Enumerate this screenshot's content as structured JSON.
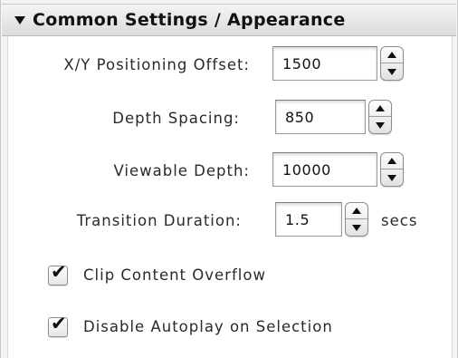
{
  "section": {
    "title": "Common Settings / Appearance",
    "collapse_icon": "disclosure-triangle-down-icon"
  },
  "fields": {
    "xy_offset": {
      "label": "X/Y Positioning Offset:",
      "value": "1500"
    },
    "depth_spacing": {
      "label": "Depth Spacing:",
      "value": "850"
    },
    "viewable_depth": {
      "label": "Viewable Depth:",
      "value": "10000"
    },
    "transition_duration": {
      "label": "Transition Duration:",
      "value": "1.5",
      "unit": "secs"
    }
  },
  "checkboxes": {
    "clip_overflow": {
      "label": "Clip Content Overflow",
      "checked": true
    },
    "disable_autoplay": {
      "label": "Disable Autoplay on Selection",
      "checked": true
    }
  },
  "icons": {
    "stepper_up": "chevron-up-icon",
    "stepper_down": "chevron-down-icon",
    "check": "checkmark-icon"
  }
}
